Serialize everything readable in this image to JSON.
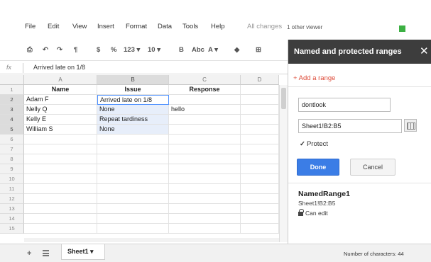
{
  "menu": {
    "items": [
      "File",
      "Edit",
      "View",
      "Insert",
      "Format",
      "Data",
      "Tools",
      "Help"
    ],
    "status": "All changes",
    "viewers": "1 other viewer"
  },
  "toolbar": {
    "items": [
      "$",
      "%",
      "123 ▾",
      "10 ▾",
      "B",
      "Abc",
      "A ▾"
    ]
  },
  "formula_bar": {
    "fx": "fx",
    "value": "Arrived late on 1/8"
  },
  "grid": {
    "columns": [
      "A",
      "B",
      "C",
      "D"
    ],
    "rows": [
      "1",
      "2",
      "3",
      "4",
      "5",
      "6",
      "7",
      "8",
      "9",
      "10",
      "11",
      "12",
      "13",
      "14",
      "15"
    ],
    "cells": {
      "A1": "Name",
      "B1": "Issue",
      "C1": "Response",
      "A2": "Adam F",
      "B2": "Arrived late on 1/8",
      "A3": "Nelly Q",
      "B3": "None",
      "C3": "hello",
      "A4": "Kelly E",
      "B4": "Repeat tardiness",
      "A5": "William S",
      "B5": "None"
    },
    "selected_column": "B",
    "selected_rows": [
      "2",
      "3",
      "4",
      "5"
    ],
    "active_cell": "B2"
  },
  "sheets": {
    "tabs": [
      "Sheet1 ▾"
    ],
    "status": "Number of characters: 44"
  },
  "panel": {
    "title": "Named and protected ranges",
    "add_range": "+ Add a range",
    "name_value": "dontlook",
    "range_value": "Sheet1!B2:B5",
    "protect_label": "Protect",
    "protect_checked": true,
    "done_label": "Done",
    "cancel_label": "Cancel",
    "existing_range": {
      "name": "NamedRange1",
      "range": "Sheet1!B2:B5",
      "permission": "Can edit"
    }
  },
  "colors": {
    "panel_header": "#3d3d3d",
    "accent_blue": "#3b7de6",
    "add_link": "#dd4b39",
    "selection": "#e7eefa",
    "viewer_indicator": "#3cb043"
  }
}
